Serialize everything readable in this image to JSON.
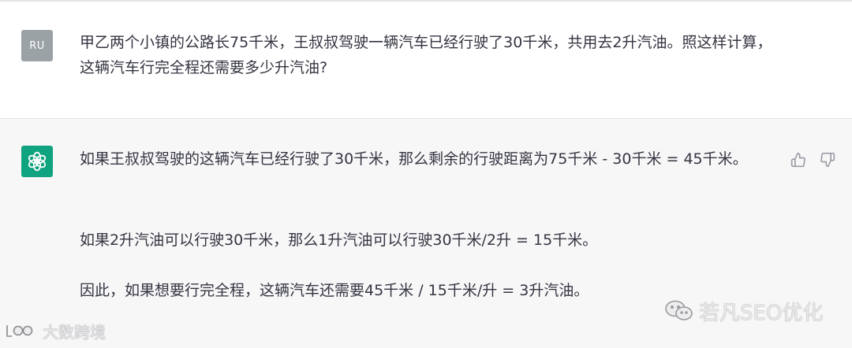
{
  "user_message": {
    "avatar_text": "RU",
    "text": "甲乙两个小镇的公路长75千米，王叔叔驾驶一辆汽车已经行驶了30千米，共用去2升汽油。照这样计算，这辆汽车行完全程还需要多少升汽油?"
  },
  "assistant_message": {
    "avatar_icon": "openai-logo-icon",
    "paragraphs": [
      "如果王叔叔驾驶的这辆汽车已经行驶了30千米，那么剩余的行驶距离为75千米 - 30千米 = 45千米。",
      "如果2升汽油可以行驶30千米，那么1升汽油可以行驶30千米/2升 = 15千米。",
      "因此，如果想要行完全程，这辆汽车还需要45千米 / 15千米/升 = 3升汽油。"
    ],
    "feedback": [
      "thumbs-up-icon",
      "thumbs-down-icon"
    ]
  },
  "watermarks": {
    "right": "若凡SEO优化",
    "left": "大数跨境"
  },
  "colors": {
    "assistant_avatar_bg": "#10a37f",
    "user_avatar_bg": "#9aa2a6",
    "assistant_row_bg": "#f7f7f8",
    "text": "#343541"
  }
}
